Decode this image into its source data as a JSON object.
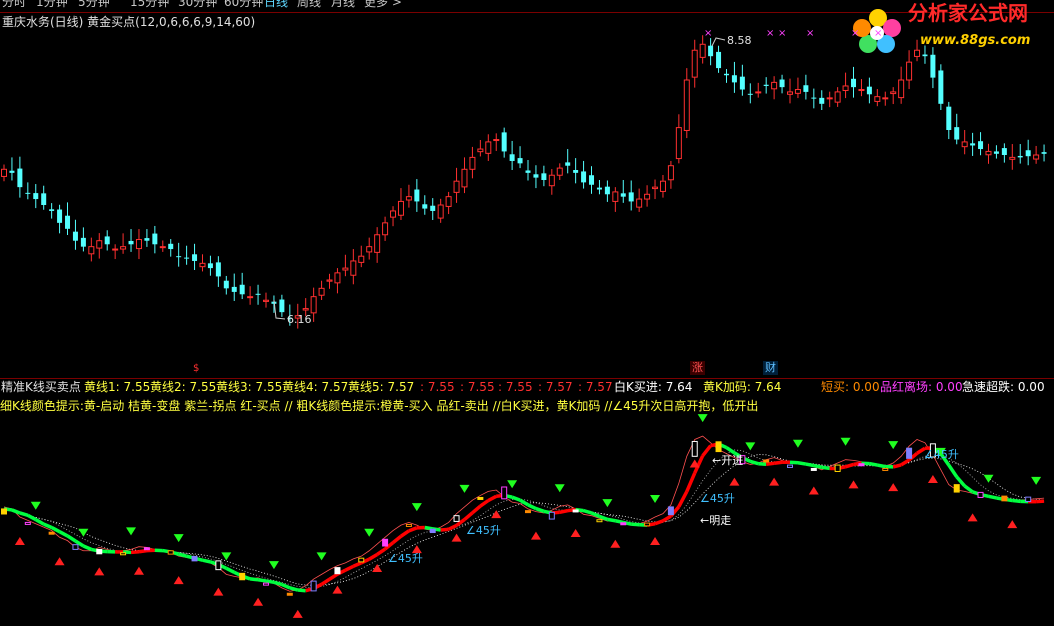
{
  "period_bar": {
    "items": [
      {
        "label": "分时",
        "active": false
      },
      {
        "label": "1分钟",
        "active": false
      },
      {
        "label": "5分钟",
        "active": false
      },
      {
        "label": "15分钟",
        "active": false
      },
      {
        "label": "30分钟",
        "active": false
      },
      {
        "label": "60分钟",
        "active": false
      },
      {
        "label": "日线",
        "active": true
      },
      {
        "label": "周线",
        "active": false
      },
      {
        "label": "月线",
        "active": false
      },
      {
        "label": "更多 >",
        "active": false
      }
    ]
  },
  "main_chart": {
    "title": "重庆水务(日线) 黄金买点(12,0,6,6,6,9,14,60)",
    "high_label": "8.58",
    "low_label": "6.16",
    "marker_up": "$",
    "marker_zhang": "涨",
    "marker_cai": "财"
  },
  "logo": {
    "text": "分析家公式网",
    "url": "www.88gs.com"
  },
  "indicator": {
    "name": "精准K线买卖点",
    "values": [
      {
        "text": "黄线1: 7.55",
        "color": "#ffff40"
      },
      {
        "text": "黄线2: 7.55",
        "color": "#ffff40"
      },
      {
        "text": "黄线3: 7.55",
        "color": "#ffff40"
      },
      {
        "text": "黄线4: 7.57",
        "color": "#ffff40"
      },
      {
        "text": "黄线5: 7.57",
        "color": "#ffff40"
      },
      {
        "text": ": 7.55",
        "color": "#ff3030"
      },
      {
        "text": ": 7.55",
        "color": "#ff3030"
      },
      {
        "text": ": 7.55",
        "color": "#ff3030"
      },
      {
        "text": ": 7.57",
        "color": "#ff3030"
      },
      {
        "text": ": 7.57",
        "color": "#ff3030"
      },
      {
        "text": "白K买进: 7.64",
        "color": "#ffffff"
      },
      {
        "text": "黄K加码: 7.64",
        "color": "#ffff40"
      },
      {
        "text": "短买: 0.00",
        "color": "#ff8a00"
      },
      {
        "text": "品红离场: 0.00",
        "color": "#ff40ff"
      },
      {
        "text": "急速超跌: 0.00",
        "color": "#ffffff"
      }
    ],
    "hint": "细K线颜色提示:黄-启动 桔黄-变盘 紫兰-拐点 红-买点 // 粗K线颜色提示:橙黄-买入 品红-卖出 //白K买进，黄K加码 //∠45升次日高开抱，低开出",
    "annotations": [
      {
        "text": "←开进",
        "color": "#ffffff"
      },
      {
        "text": "←明走",
        "color": "#ffffff"
      },
      {
        "text": "∠45升",
        "color": "#40c0ff"
      },
      {
        "text": "∠45升",
        "color": "#40c0ff"
      },
      {
        "text": "∠45升",
        "color": "#40c0ff"
      },
      {
        "text": "∠45升",
        "color": "#40c0ff"
      }
    ]
  },
  "colors": {
    "up": "#ff3030",
    "down": "#54ffff",
    "divider": "#7a0000",
    "trend_up": "#ff0000",
    "trend_down": "#00ff40"
  },
  "chart_data": {
    "type": "candlestick",
    "title": "重庆水务(日线) 黄金买点(12,0,6,6,6,9,14,60)",
    "marked_high": 8.58,
    "marked_low": 6.16,
    "closes": [
      7.45,
      7.42,
      7.3,
      7.25,
      7.2,
      7.15,
      7.1,
      7.0,
      6.95,
      6.85,
      6.8,
      6.8,
      6.85,
      6.82,
      6.78,
      6.8,
      6.82,
      6.86,
      6.85,
      6.82,
      6.8,
      6.78,
      6.72,
      6.7,
      6.68,
      6.66,
      6.62,
      6.55,
      6.45,
      6.42,
      6.4,
      6.38,
      6.4,
      6.35,
      6.32,
      6.25,
      6.2,
      6.22,
      6.28,
      6.38,
      6.45,
      6.52,
      6.58,
      6.62,
      6.68,
      6.72,
      6.8,
      6.9,
      7.0,
      7.1,
      7.18,
      7.22,
      7.18,
      7.12,
      7.1,
      7.15,
      7.22,
      7.35,
      7.45,
      7.55,
      7.62,
      7.68,
      7.7,
      7.6,
      7.52,
      7.5,
      7.42,
      7.38,
      7.36,
      7.4,
      7.46,
      7.48,
      7.42,
      7.34,
      7.32,
      7.28,
      7.24,
      7.26,
      7.22,
      7.18,
      7.2,
      7.24,
      7.3,
      7.35,
      7.48,
      7.8,
      8.2,
      8.45,
      8.5,
      8.4,
      8.3,
      8.24,
      8.18,
      8.12,
      8.08,
      8.1,
      8.15,
      8.18,
      8.14,
      8.1,
      8.12,
      8.1,
      8.05,
      8.0,
      8.05,
      8.1,
      8.15,
      8.14,
      8.12,
      8.08,
      8.06,
      8.05,
      8.1,
      8.2,
      8.35,
      8.45,
      8.4,
      8.22,
      8.0,
      7.78,
      7.7,
      7.68,
      7.65,
      7.62,
      7.6,
      7.58,
      7.57,
      7.55,
      7.55,
      7.56,
      7.57,
      7.58
    ]
  }
}
